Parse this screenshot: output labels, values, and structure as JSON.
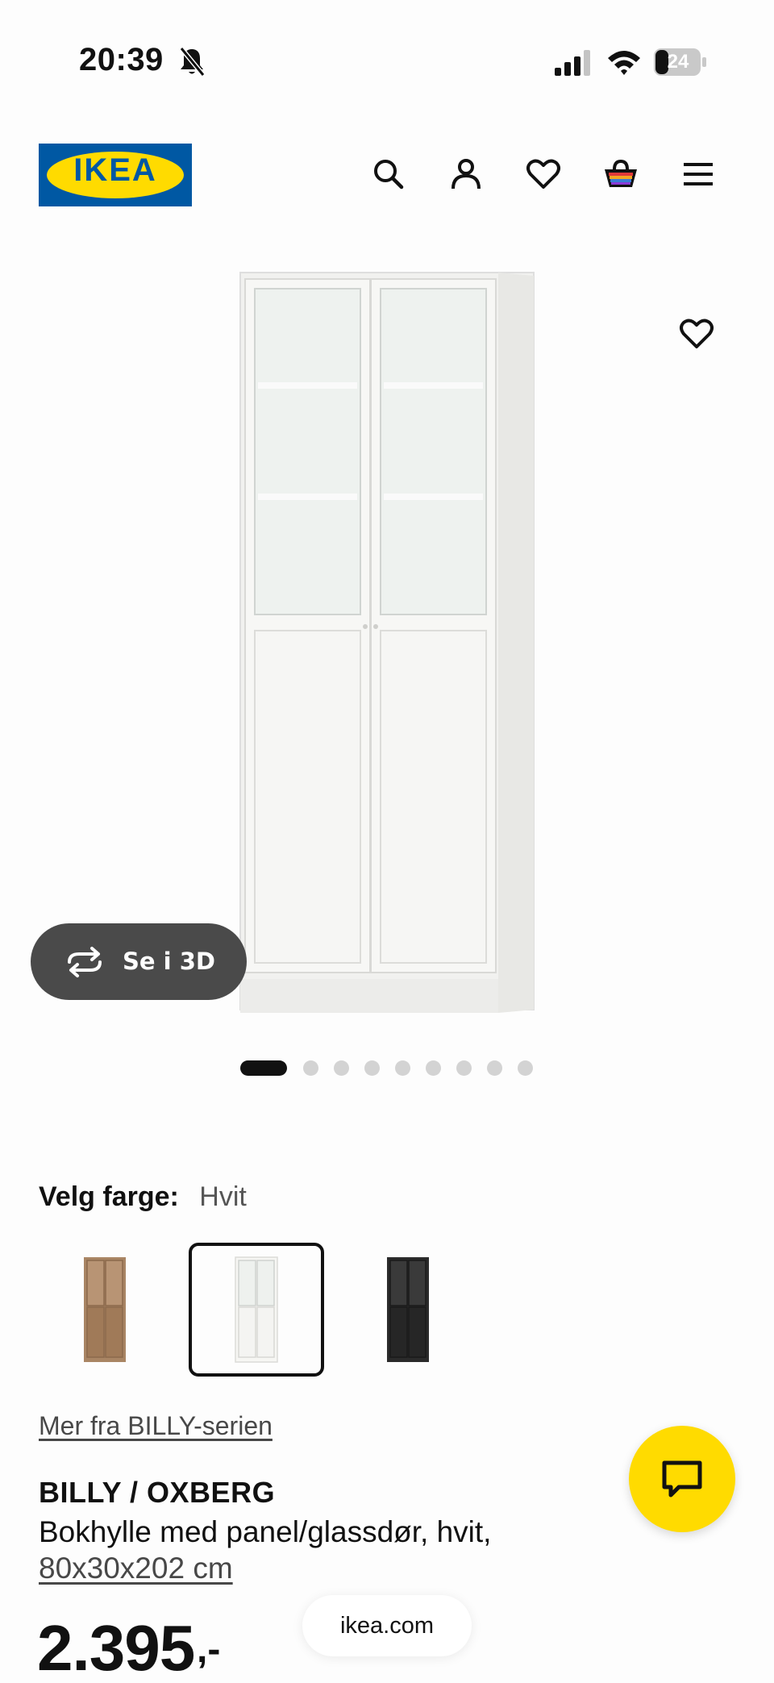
{
  "status_bar": {
    "time": "20:39",
    "battery": "24"
  },
  "header": {
    "logo_text": "IKEA",
    "icons": [
      "search-icon",
      "account-icon",
      "favourites-icon",
      "basket-icon",
      "menu-icon"
    ]
  },
  "gallery": {
    "view_3d_label": "Se i 3D",
    "image_count": 9,
    "active_index": 0
  },
  "color": {
    "label": "Velg farge:",
    "value": "Hvit",
    "options": [
      {
        "name": "oak",
        "color": "#a98564",
        "selected": false
      },
      {
        "name": "white",
        "color": "#f6f6f3",
        "selected": true
      },
      {
        "name": "black",
        "color": "#2b2b2b",
        "selected": false
      }
    ]
  },
  "product": {
    "series_link": "Mer fra BILLY-serien",
    "name": "BILLY / OXBERG",
    "description": "Bokhylle med panel/glassdør, hvit,",
    "dimensions": "80x30x202 cm",
    "price": "2.395",
    "price_suffix": ",-"
  },
  "browser": {
    "url": "ikea.com"
  },
  "colors": {
    "ikea_blue": "#0058a3",
    "ikea_yellow": "#ffdb00"
  }
}
